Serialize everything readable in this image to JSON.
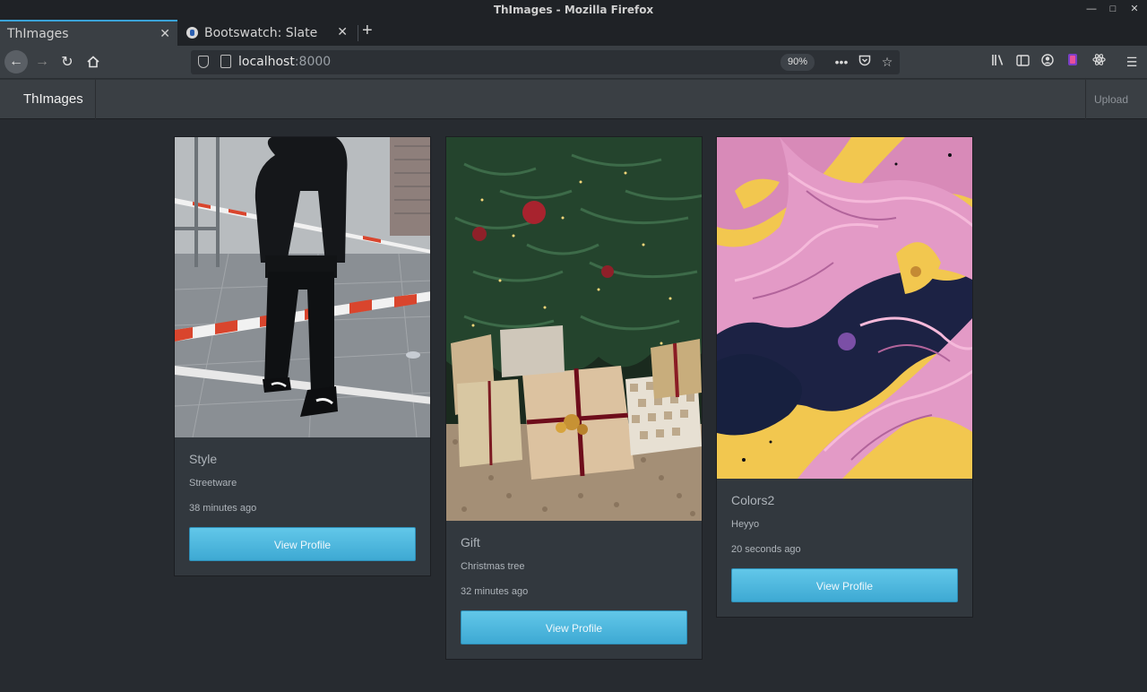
{
  "window": {
    "title": "ThImages - Mozilla Firefox"
  },
  "tabs": [
    {
      "label": "ThImages",
      "active": true
    },
    {
      "label": "Bootswatch: Slate",
      "active": false
    }
  ],
  "toolbar": {
    "url_host": "localhost",
    "url_port": ":8000",
    "zoom": "90%"
  },
  "app": {
    "brand": "ThImages",
    "upload_label": "Upload"
  },
  "cards": [
    {
      "name": "Style",
      "description": "Streetware",
      "time": "38 minutes ago",
      "button": "View Profile",
      "image": "streetwear-photo"
    },
    {
      "name": "Gift",
      "description": "Christmas tree",
      "time": "32 minutes ago",
      "button": "View Profile",
      "image": "christmas-tree-photo"
    },
    {
      "name": "Colors2",
      "description": "Heyyo",
      "time": "20 seconds ago",
      "button": "View Profile",
      "image": "pink-yellow-marble-photo"
    }
  ],
  "colors": {
    "page_bg": "#272b30",
    "card_bg": "#32383e",
    "button": "#4fbbe0",
    "tab_accent": "#3aa3d8"
  }
}
